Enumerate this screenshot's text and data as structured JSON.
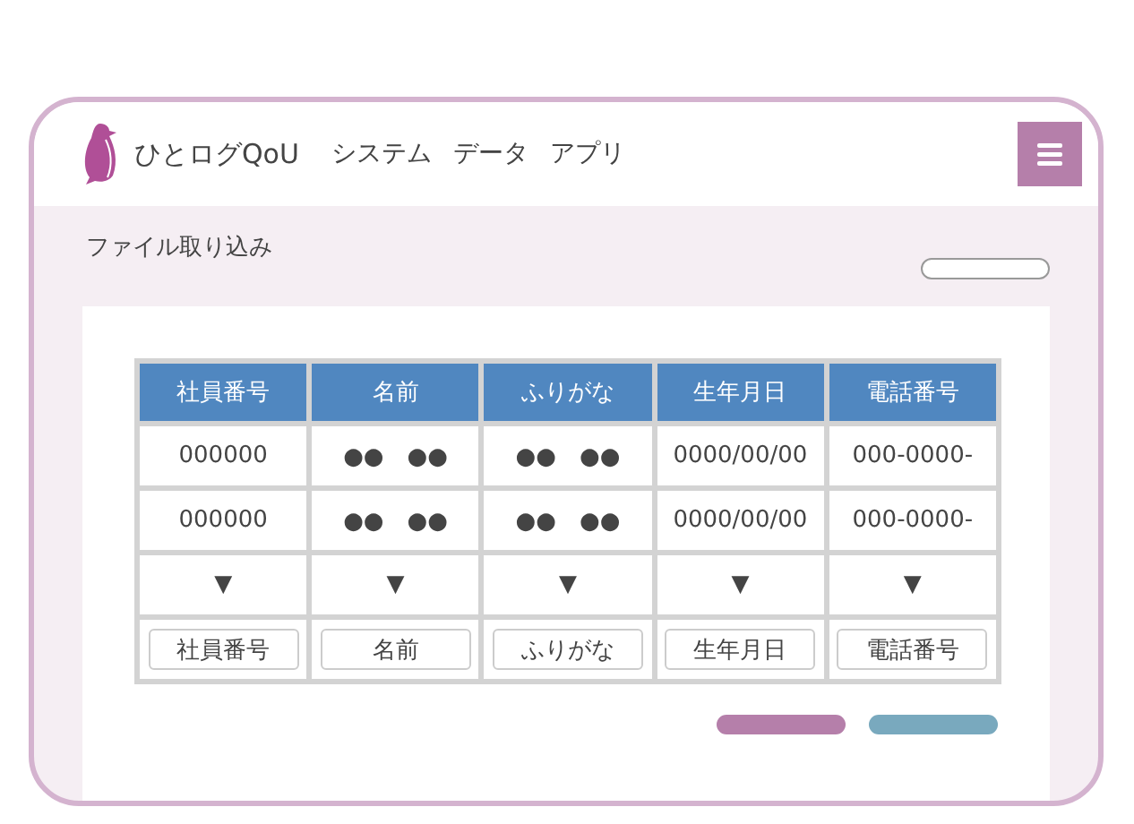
{
  "header": {
    "app_name": "ひとログQoU",
    "menu": [
      "システム",
      "データ",
      "アプリ"
    ]
  },
  "page_title": "ファイル取り込み",
  "table": {
    "columns": [
      "社員番号",
      "名前",
      "ふりがな",
      "生年月日",
      "電話番号"
    ],
    "rows": [
      [
        "000000",
        "●●　●●",
        "●●　●●",
        "0000/00/00",
        "000-0000-"
      ],
      [
        "000000",
        "●●　●●",
        "●●　●●",
        "0000/00/00",
        "000-0000-"
      ]
    ],
    "arrows": [
      "▼",
      "▼",
      "▼",
      "▼",
      "▼"
    ],
    "field_selectors": [
      "社員番号",
      "名前",
      "ふりがな",
      "生年月日",
      "電話番号"
    ]
  },
  "actions": [
    {
      "color": "#b57faa"
    },
    {
      "color": "#79a9be"
    }
  ]
}
